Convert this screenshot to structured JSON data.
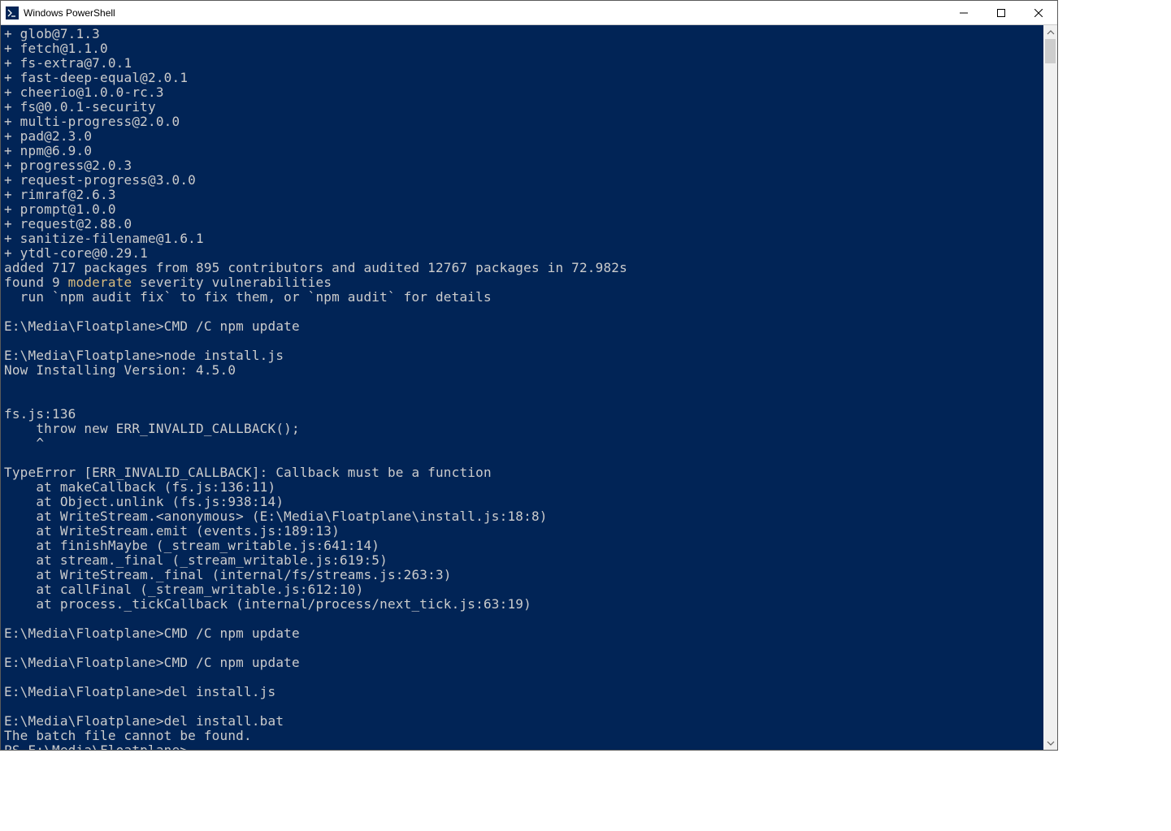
{
  "window": {
    "title": "Windows PowerShell"
  },
  "colors": {
    "terminal_bg": "#012456",
    "terminal_fg": "#cccccc",
    "moderate": "#d7ba7d"
  },
  "terminal": {
    "lines": [
      {
        "t": "+ glob@7.1.3"
      },
      {
        "t": "+ fetch@1.1.0"
      },
      {
        "t": "+ fs-extra@7.0.1"
      },
      {
        "t": "+ fast-deep-equal@2.0.1"
      },
      {
        "t": "+ cheerio@1.0.0-rc.3"
      },
      {
        "t": "+ fs@0.0.1-security"
      },
      {
        "t": "+ multi-progress@2.0.0"
      },
      {
        "t": "+ pad@2.3.0"
      },
      {
        "t": "+ npm@6.9.0"
      },
      {
        "t": "+ progress@2.0.3"
      },
      {
        "t": "+ request-progress@3.0.0"
      },
      {
        "t": "+ rimraf@2.6.3"
      },
      {
        "t": "+ prompt@1.0.0"
      },
      {
        "t": "+ request@2.88.0"
      },
      {
        "t": "+ sanitize-filename@1.6.1"
      },
      {
        "t": "+ ytdl-core@0.29.1"
      },
      {
        "t": "added 717 packages from 895 contributors and audited 12767 packages in 72.982s"
      },
      {
        "segments": [
          {
            "t": "found 9 "
          },
          {
            "t": "moderate",
            "c": "moderate"
          },
          {
            "t": " severity vulnerabilities"
          }
        ]
      },
      {
        "t": "  run `npm audit fix` to fix them, or `npm audit` for details"
      },
      {
        "t": ""
      },
      {
        "t": "E:\\Media\\Floatplane>CMD /C npm update"
      },
      {
        "t": ""
      },
      {
        "t": "E:\\Media\\Floatplane>node install.js"
      },
      {
        "t": "Now Installing Version: 4.5.0"
      },
      {
        "t": ""
      },
      {
        "t": ""
      },
      {
        "t": "fs.js:136"
      },
      {
        "t": "    throw new ERR_INVALID_CALLBACK();"
      },
      {
        "t": "    ^"
      },
      {
        "t": ""
      },
      {
        "t": "TypeError [ERR_INVALID_CALLBACK]: Callback must be a function"
      },
      {
        "t": "    at makeCallback (fs.js:136:11)"
      },
      {
        "t": "    at Object.unlink (fs.js:938:14)"
      },
      {
        "t": "    at WriteStream.<anonymous> (E:\\Media\\Floatplane\\install.js:18:8)"
      },
      {
        "t": "    at WriteStream.emit (events.js:189:13)"
      },
      {
        "t": "    at finishMaybe (_stream_writable.js:641:14)"
      },
      {
        "t": "    at stream._final (_stream_writable.js:619:5)"
      },
      {
        "t": "    at WriteStream._final (internal/fs/streams.js:263:3)"
      },
      {
        "t": "    at callFinal (_stream_writable.js:612:10)"
      },
      {
        "t": "    at process._tickCallback (internal/process/next_tick.js:63:19)"
      },
      {
        "t": ""
      },
      {
        "t": "E:\\Media\\Floatplane>CMD /C npm update"
      },
      {
        "t": ""
      },
      {
        "t": "E:\\Media\\Floatplane>CMD /C npm update"
      },
      {
        "t": ""
      },
      {
        "t": "E:\\Media\\Floatplane>del install.js"
      },
      {
        "t": ""
      },
      {
        "t": "E:\\Media\\Floatplane>del install.bat"
      },
      {
        "t": "The batch file cannot be found."
      }
    ],
    "prompt": "PS E:\\Media\\Floatplane> "
  }
}
